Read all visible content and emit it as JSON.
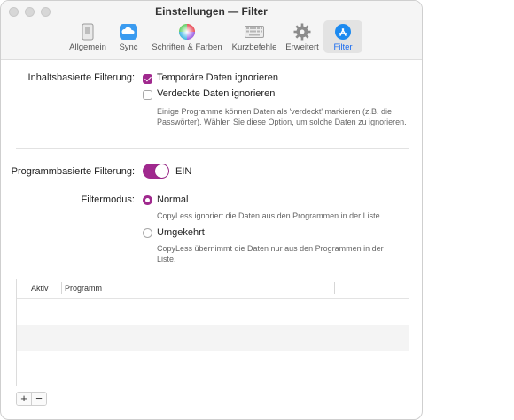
{
  "window": {
    "title": "Einstellungen — Filter"
  },
  "tabs": [
    {
      "label": "Allgemein",
      "icon": "phone-icon"
    },
    {
      "label": "Sync",
      "icon": "cloud-icon"
    },
    {
      "label": "Schriften & Farben",
      "icon": "color-wheel-icon"
    },
    {
      "label": "Kurzbefehle",
      "icon": "keyboard-icon"
    },
    {
      "label": "Erweitert",
      "icon": "gear-icon"
    },
    {
      "label": "Filter",
      "icon": "app-store-icon",
      "active": true
    }
  ],
  "content_filter": {
    "label": "Inhaltsbasierte Filterung:",
    "options": [
      {
        "label": "Temporäre Daten ignorieren",
        "checked": true
      },
      {
        "label": "Verdeckte Daten ignorieren",
        "checked": false
      }
    ],
    "help": "Einige Programme können Daten als 'verdeckt' markieren (z.B. die Passwörter). Wählen Sie diese Option, um solche Daten zu ignorieren."
  },
  "program_filter": {
    "label": "Programmbasierte Filterung:",
    "toggle_state": "EIN",
    "enabled": true
  },
  "filter_mode": {
    "label": "Filtermodus:",
    "options": [
      {
        "label": "Normal",
        "selected": true,
        "help": "CopyLess ignoriert die Daten aus den Programmen in der Liste."
      },
      {
        "label": "Umgekehrt",
        "selected": false,
        "help": "CopyLess übernimmt die Daten nur aus den Programmen in der Liste."
      }
    ]
  },
  "program_table": {
    "columns": [
      "Aktiv",
      "Programm"
    ],
    "rows": []
  },
  "table_buttons": {
    "add": "+",
    "remove": "−"
  },
  "colors": {
    "accent": "#a0298e",
    "tab_active": "#1a6cf0"
  }
}
